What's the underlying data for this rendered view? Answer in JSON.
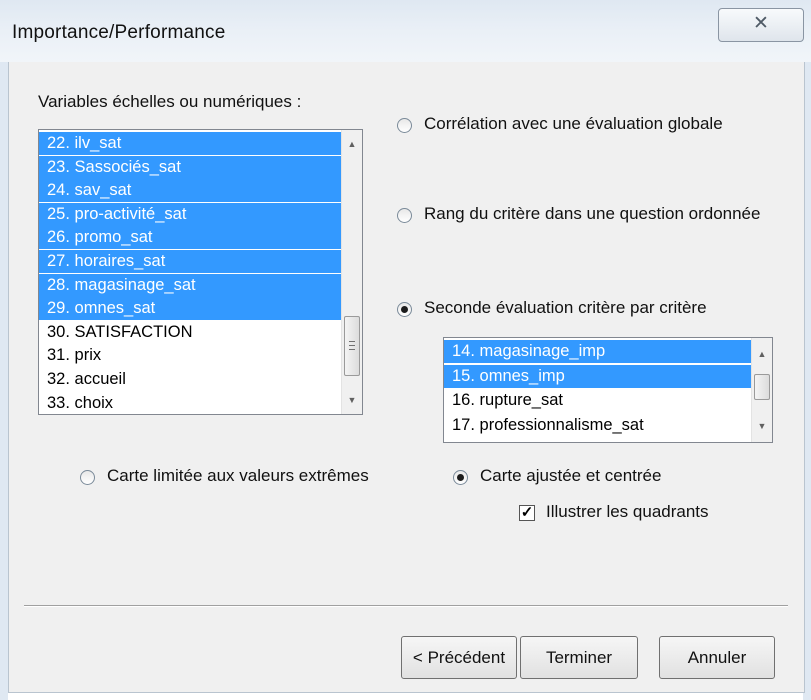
{
  "window": {
    "title": "Importance/Performance",
    "close_glyph": "✕"
  },
  "left_panel": {
    "label": "Variables échelles ou numériques :",
    "items": [
      {
        "text": "22. ilv_sat",
        "selected": true
      },
      {
        "text": "23. Sassociés_sat",
        "selected": true
      },
      {
        "text": "24. sav_sat",
        "selected": true
      },
      {
        "text": "25. pro-activité_sat",
        "selected": true
      },
      {
        "text": "26. promo_sat",
        "selected": true
      },
      {
        "text": "27. horaires_sat",
        "selected": true
      },
      {
        "text": "28. magasinage_sat",
        "selected": true
      },
      {
        "text": "29. omnes_sat",
        "selected": true
      },
      {
        "text": "30. SATISFACTION",
        "selected": false
      },
      {
        "text": "31. prix",
        "selected": false
      },
      {
        "text": "32. accueil",
        "selected": false
      },
      {
        "text": "33. choix",
        "selected": false
      }
    ]
  },
  "options": {
    "correlation": {
      "label": "Corrélation avec une évaluation globale",
      "checked": false
    },
    "rang": {
      "label": "Rang du critère dans une question ordonnée",
      "checked": false
    },
    "seconde": {
      "label": "Seconde évaluation critère par critère",
      "checked": true
    }
  },
  "right_list": {
    "items": [
      {
        "text": "14. magasinage_imp",
        "selected": true
      },
      {
        "text": "15. omnes_imp",
        "selected": true
      },
      {
        "text": "16. rupture_sat",
        "selected": false
      },
      {
        "text": "17. professionnalisme_sat",
        "selected": false
      }
    ]
  },
  "map_options": {
    "limitee": {
      "label": "Carte limitée aux valeurs extrêmes",
      "checked": false
    },
    "ajustee": {
      "label": "Carte ajustée et centrée",
      "checked": true
    },
    "quadrants": {
      "label": "Illustrer les quadrants",
      "checked": true
    }
  },
  "buttons": {
    "previous": "< Précédent",
    "finish": "Terminer",
    "cancel": "Annuler"
  }
}
